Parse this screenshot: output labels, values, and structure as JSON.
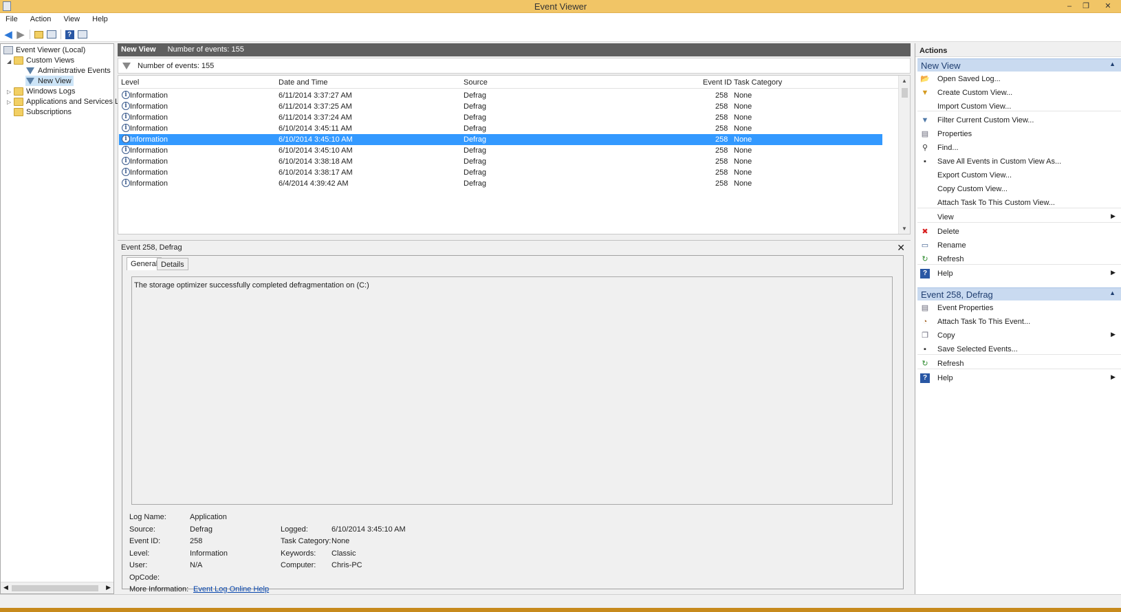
{
  "window": {
    "title": "Event Viewer",
    "minimize": "–",
    "restore": "❐",
    "close": "✕"
  },
  "menu": [
    "File",
    "Action",
    "View",
    "Help"
  ],
  "tree": {
    "root": "Event Viewer (Local)",
    "custom_views": "Custom Views",
    "admin_events": "Administrative Events",
    "new_view": "New View",
    "windows_logs": "Windows Logs",
    "apps_services": "Applications and Services Lo",
    "subscriptions": "Subscriptions"
  },
  "middle": {
    "header_title": "New View",
    "header_count": "Number of events: 155",
    "filter_text": "Number of events: 155",
    "columns": {
      "level": "Level",
      "date": "Date and Time",
      "source": "Source",
      "event_id": "Event ID",
      "task": "Task Category"
    },
    "rows": [
      {
        "level": "Information",
        "date": "6/11/2014 3:37:27 AM",
        "source": "Defrag",
        "id": "258",
        "task": "None"
      },
      {
        "level": "Information",
        "date": "6/11/2014 3:37:25 AM",
        "source": "Defrag",
        "id": "258",
        "task": "None"
      },
      {
        "level": "Information",
        "date": "6/11/2014 3:37:24 AM",
        "source": "Defrag",
        "id": "258",
        "task": "None"
      },
      {
        "level": "Information",
        "date": "6/10/2014 3:45:11 AM",
        "source": "Defrag",
        "id": "258",
        "task": "None"
      },
      {
        "level": "Information",
        "date": "6/10/2014 3:45:10 AM",
        "source": "Defrag",
        "id": "258",
        "task": "None"
      },
      {
        "level": "Information",
        "date": "6/10/2014 3:45:10 AM",
        "source": "Defrag",
        "id": "258",
        "task": "None"
      },
      {
        "level": "Information",
        "date": "6/10/2014 3:38:18 AM",
        "source": "Defrag",
        "id": "258",
        "task": "None"
      },
      {
        "level": "Information",
        "date": "6/10/2014 3:38:17 AM",
        "source": "Defrag",
        "id": "258",
        "task": "None"
      },
      {
        "level": "Information",
        "date": "6/4/2014 4:39:42 AM",
        "source": "Defrag",
        "id": "258",
        "task": "None"
      }
    ],
    "selected_row": 4
  },
  "detail": {
    "title": "Event 258, Defrag",
    "tab_general": "General",
    "tab_details": "Details",
    "description": "The storage optimizer successfully completed defragmentation on (C:)",
    "labels": {
      "log_name": "Log Name:",
      "source": "Source:",
      "event_id": "Event ID:",
      "level": "Level:",
      "user": "User:",
      "opcode": "OpCode:",
      "more_info": "More Information:",
      "logged": "Logged:",
      "task_category": "Task Category:",
      "keywords": "Keywords:",
      "computer": "Computer:"
    },
    "values": {
      "log_name": "Application",
      "source": "Defrag",
      "event_id": "258",
      "level": "Information",
      "user": "N/A",
      "opcode": "",
      "more_info_link": "Event Log Online Help",
      "logged": "6/10/2014 3:45:10 AM",
      "task_category": "None",
      "keywords": "Classic",
      "computer": "Chris-PC"
    }
  },
  "actions": {
    "title": "Actions",
    "section1": "New View",
    "items1": [
      "Open Saved Log...",
      "Create Custom View...",
      "Import Custom View...",
      "Filter Current Custom View...",
      "Properties",
      "Find...",
      "Save All Events in Custom View As...",
      "Export Custom View...",
      "Copy Custom View...",
      "Attach Task To This Custom View...",
      "View",
      "Delete",
      "Rename",
      "Refresh",
      "Help"
    ],
    "section2": "Event 258, Defrag",
    "items2": [
      "Event Properties",
      "Attach Task To This Event...",
      "Copy",
      "Save Selected Events...",
      "Refresh",
      "Help"
    ]
  },
  "colors": {
    "titlebar": "#f1c566",
    "selection": "#3399ff",
    "section_head": "#c9daf0"
  }
}
